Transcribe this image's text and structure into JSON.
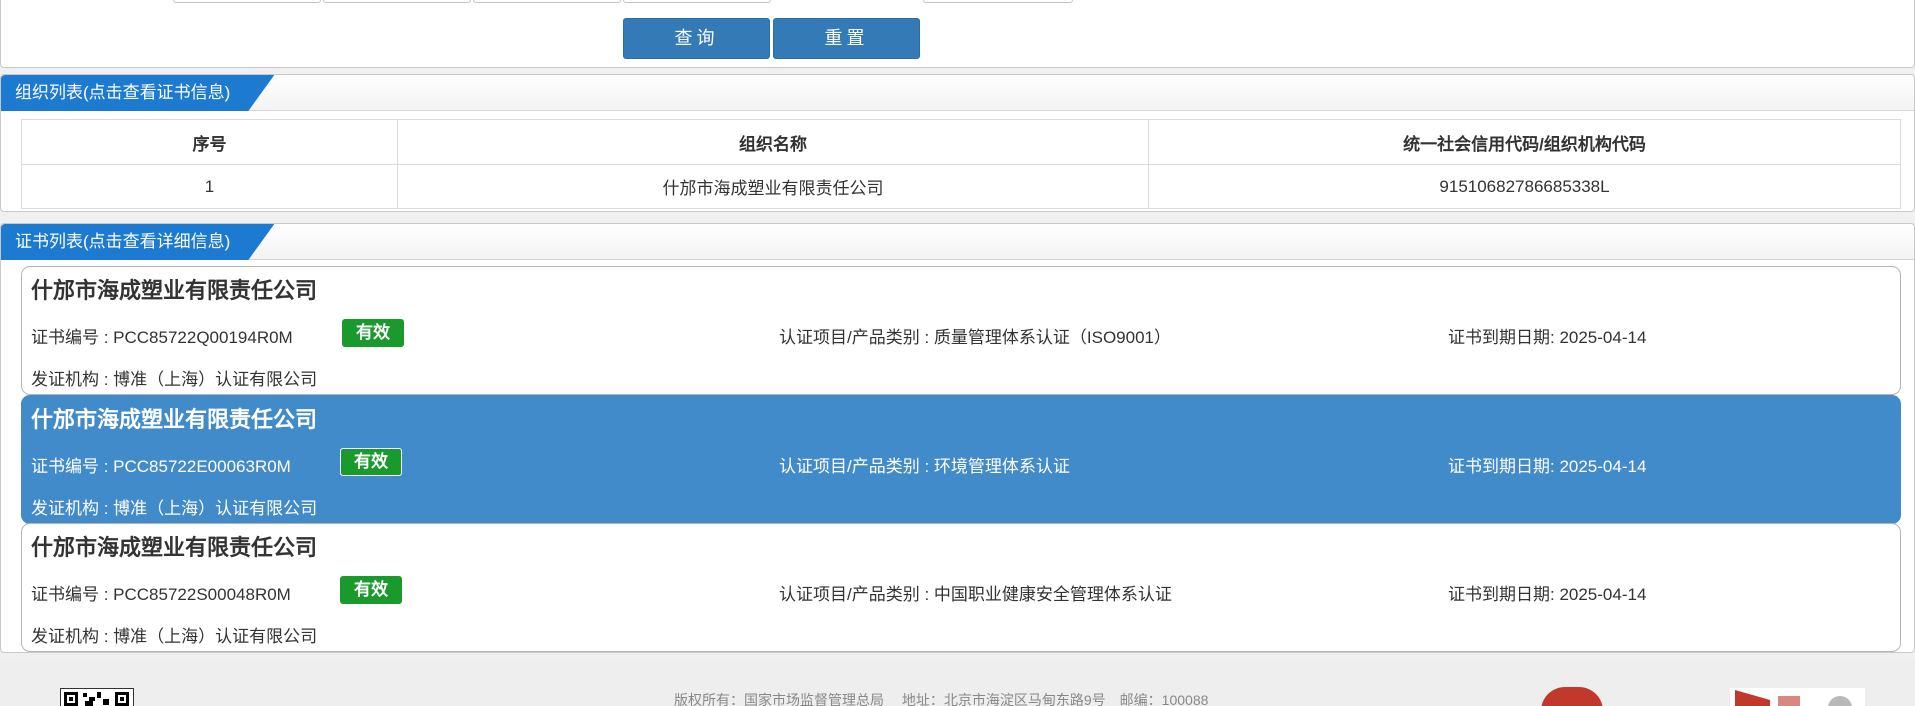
{
  "search": {
    "query_label": "查询",
    "reset_label": "重置"
  },
  "org_panel": {
    "title": "组织列表(点击查看证书信息)",
    "columns": [
      "序号",
      "组织名称",
      "统一社会信用代码/组织机构代码"
    ],
    "rows": [
      {
        "index": "1",
        "name": "什邡市海成塑业有限责任公司",
        "code": "91510682786685338L"
      }
    ]
  },
  "cert_panel": {
    "title": "证书列表(点击查看详细信息)",
    "certs": [
      {
        "company": "什邡市海成塑业有限责任公司",
        "cert_no": "证书编号 : PCC85722Q00194R0M",
        "status": "有效",
        "category": "认证项目/产品类别 : 质量管理体系认证（ISO9001）",
        "expiry": "证书到期日期: 2025-04-14",
        "issuer": "发证机构 : 博准（上海）认证有限公司"
      },
      {
        "company": "什邡市海成塑业有限责任公司",
        "cert_no": "证书编号 : PCC85722E00063R0M",
        "status": "有效",
        "category": "认证项目/产品类别 : 环境管理体系认证",
        "expiry": "证书到期日期: 2025-04-14",
        "issuer": "发证机构 : 博准（上海）认证有限公司"
      },
      {
        "company": "什邡市海成塑业有限责任公司",
        "cert_no": "证书编号 : PCC85722S00048R0M",
        "status": "有效",
        "category": "认证项目/产品类别 : 中国职业健康安全管理体系认证",
        "expiry": "证书到期日期: 2025-04-14",
        "issuer": "发证机构 : 博准（上海）认证有限公司"
      }
    ]
  },
  "footer": {
    "text": "版权所有：国家市场监督管理总局　 地址：北京市海淀区马甸东路9号　邮编：100088"
  },
  "colors": {
    "primary": "#337ab7",
    "panel_title": "#1c7ad0",
    "selected_card": "#428bca",
    "valid_badge": "#1a9a2d"
  }
}
